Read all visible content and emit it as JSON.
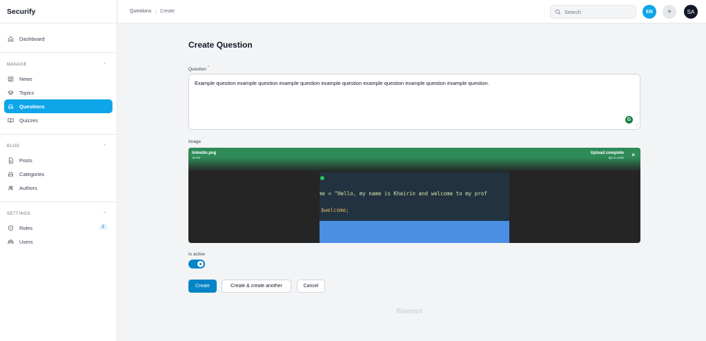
{
  "sidebar": {
    "brand": "Securify",
    "dashboard": "Dashboard",
    "groups": {
      "manage": {
        "title": "MANAGE",
        "items": [
          "News",
          "Topics",
          "Questions",
          "Quizzes"
        ]
      },
      "blog": {
        "title": "BLOG",
        "items": [
          "Posts",
          "Categories",
          "Authors"
        ]
      },
      "settings": {
        "title": "SETTINGS",
        "items": [
          "Roles",
          "Users"
        ],
        "roles_badge": "2"
      }
    },
    "active_item": "Questions"
  },
  "topbar": {
    "breadcrumb": [
      "Questions",
      "Create"
    ],
    "search_placeholder": "Search",
    "locale": "EN",
    "add_symbol": "+",
    "user_initials": "SA"
  },
  "form": {
    "title": "Create Question",
    "question_label": "Question",
    "required_mark": "*",
    "question_value": "Example question example question example question example question example question example question example question.",
    "image_label": "Image",
    "upload": {
      "file_name": "linkedin.png",
      "file_size": "16 KB",
      "status": "Upload complete",
      "undo_hint": "tap to undo",
      "close_symbol": "×",
      "code_line_1": "come = \"Hello, my name is Khairin and welcome to my prof",
      "code_line_2": "$welcome;"
    },
    "active_label": "Is active",
    "active_value": true,
    "buttons": {
      "create": "Create",
      "create_another": "Create & create another",
      "cancel": "Cancel"
    }
  },
  "footer": {
    "brand": "filament"
  },
  "colors": {
    "primary": "#0284c7",
    "active_nav": "#0ea5e9",
    "upload_success": "#2e8b57"
  }
}
